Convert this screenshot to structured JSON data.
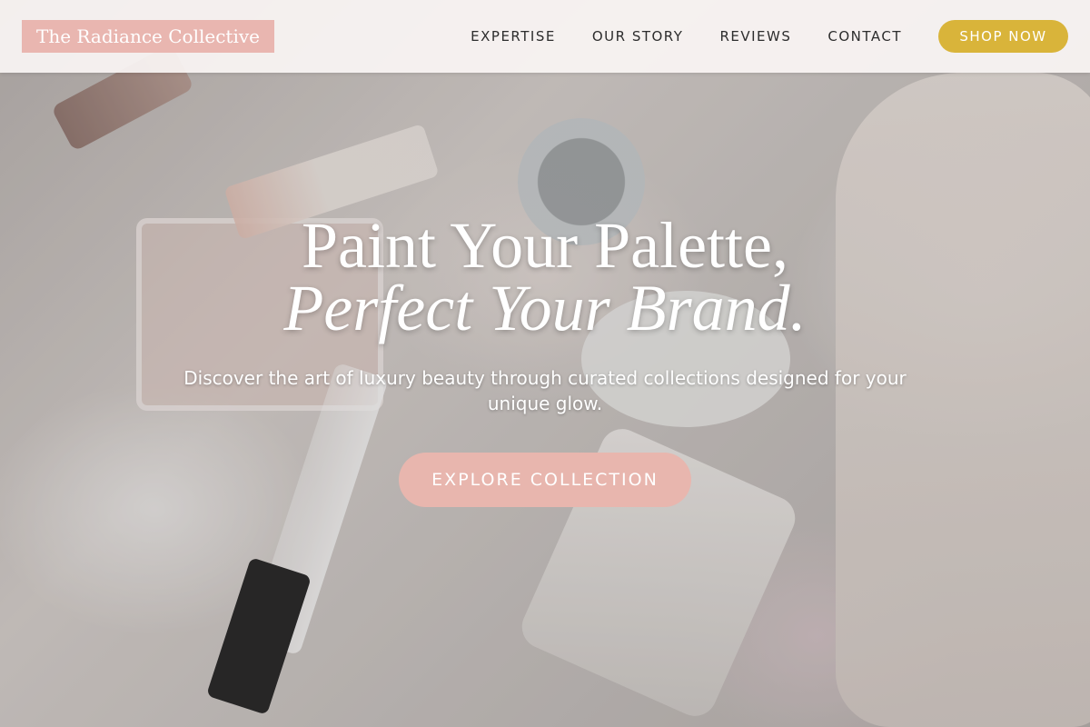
{
  "nav": {
    "brand": "The Radiance Collective",
    "links": [
      "EXPERTISE",
      "OUR STORY",
      "REVIEWS",
      "CONTACT"
    ],
    "cta": "SHOP NOW"
  },
  "hero": {
    "headline_line1": "Paint Your Palette,",
    "headline_line2": "Perfect Your Brand.",
    "subtext": "Discover the art of luxury beauty through curated collections designed for your unique glow.",
    "cta": "EXPLORE COLLECTION"
  },
  "colors": {
    "brand_pink": "#e9b6b0",
    "gold": "#d9b43a",
    "button_pink": "#e8b6ae"
  }
}
